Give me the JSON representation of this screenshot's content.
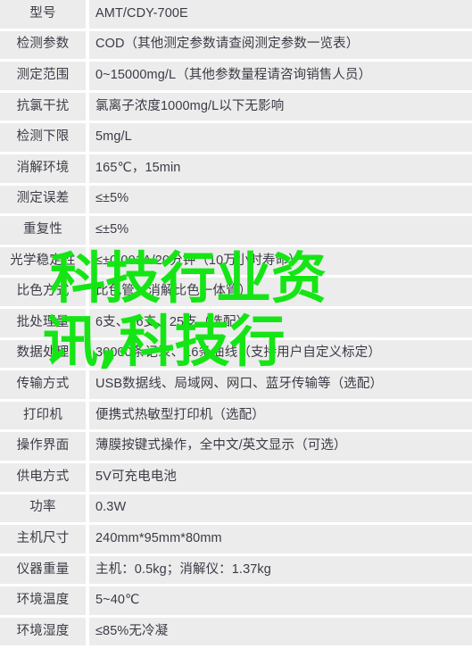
{
  "document": {
    "kind": "product-specification-table",
    "colors": {
      "cell_background": "#ececec",
      "gap": "#ffffff",
      "text": "#3b3b46",
      "watermark_green": "#15e515"
    }
  },
  "spec_table": {
    "rows": [
      {
        "label": "型号",
        "value": "AMT/CDY-700E"
      },
      {
        "label": "检测参数",
        "value": "COD（其他测定参数请查阅测定参数一览表）"
      },
      {
        "label": "测定范围",
        "value": "0~15000mg/L（其他参数量程请咨询销售人员）"
      },
      {
        "label": "抗氯干扰",
        "value": "氯离子浓度1000mg/L以下无影响"
      },
      {
        "label": "检测下限",
        "value": "5mg/L"
      },
      {
        "label": "消解环境",
        "value": "165℃，15min"
      },
      {
        "label": "测定误差",
        "value": "≤±5%"
      },
      {
        "label": "重复性",
        "value": "≤±5%"
      },
      {
        "label": "光学稳定性",
        "value": "≤±0.001A/20分钟（10万小时寿命）"
      },
      {
        "label": "比色方式",
        "value": "比色管（消解比色一体管）"
      },
      {
        "label": "批处理量",
        "value": "6支、16支、25支（选配）"
      },
      {
        "label": "数据处理",
        "value": "30000条记录、16条曲线（支持用户自定义标定）"
      },
      {
        "label": "传输方式",
        "value": "USB数据线、局域网、网口、蓝牙传输等（选配）"
      },
      {
        "label": "打印机",
        "value": "便携式热敏型打印机（选配）"
      },
      {
        "label": "操作界面",
        "value": "薄膜按键式操作，全中文/英文显示（可选）"
      },
      {
        "label": "供电方式",
        "value": "5V可充电电池"
      },
      {
        "label": "功率",
        "value": "0.3W"
      },
      {
        "label": "主机尺寸",
        "value": "240mm*95mm*80mm"
      },
      {
        "label": "仪器重量",
        "value": "主机：0.5kg；消解仪：1.37kg"
      },
      {
        "label": "环境温度",
        "value": "5~40℃"
      },
      {
        "label": "环境湿度",
        "value": "≤85%无冷凝"
      }
    ]
  },
  "watermark": {
    "line1": "科技行业资",
    "line2": "讯,科技行"
  }
}
